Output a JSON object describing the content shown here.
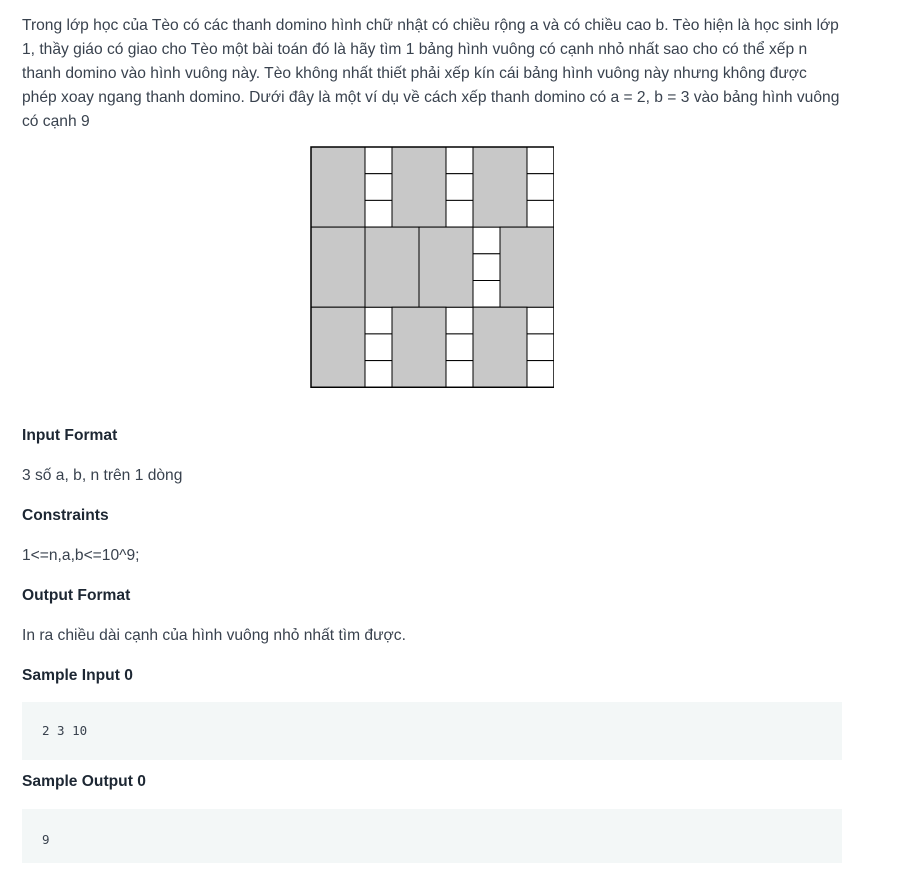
{
  "problem": {
    "statement": "Trong lớp học của Tèo có các thanh domino hình chữ nhật có chiều rộng a và có chiều cao b. Tèo hiện là học sinh lớp 1, thầy giáo có giao cho Tèo một bài toán đó là hãy tìm 1 bảng hình vuông có cạnh nhỏ nhất sao cho có thể xếp n thanh domino vào hình vuông này. Tèo không nhất thiết phải xếp kín cái bảng hình vuông này nhưng không được phép xoay ngang thanh domino. Dưới đây là một ví dụ về cách xếp thanh domino có a = 2, b = 3 vào bảng hình vuông có cạnh 9"
  },
  "figure": {
    "grid_size": 9,
    "domino_width": 2,
    "domino_height": 3,
    "fill_color": "#c8c8c8",
    "empty_color": "#ffffff",
    "line_color": "#000000",
    "dominoes": [
      {
        "col": 0,
        "row": 0
      },
      {
        "col": 3,
        "row": 0
      },
      {
        "col": 6,
        "row": 0
      },
      {
        "col": 0,
        "row": 3
      },
      {
        "col": 2,
        "row": 3
      },
      {
        "col": 4,
        "row": 3
      },
      {
        "col": 7,
        "row": 3
      },
      {
        "col": 0,
        "row": 6
      },
      {
        "col": 3,
        "row": 6
      },
      {
        "col": 6,
        "row": 6
      }
    ]
  },
  "sections": {
    "input_format_heading": "Input Format",
    "input_format_text": "3 số a, b, n trên 1 dòng",
    "constraints_heading": "Constraints",
    "constraints_text": "1<=n,a,b<=10^9;",
    "output_format_heading": "Output Format",
    "output_format_text": "In ra chiều dài cạnh của hình vuông nhỏ nhất tìm được.",
    "sample_input_heading": "Sample Input 0",
    "sample_input": "2 3 10",
    "sample_output_heading": "Sample Output 0",
    "sample_output": "9"
  }
}
